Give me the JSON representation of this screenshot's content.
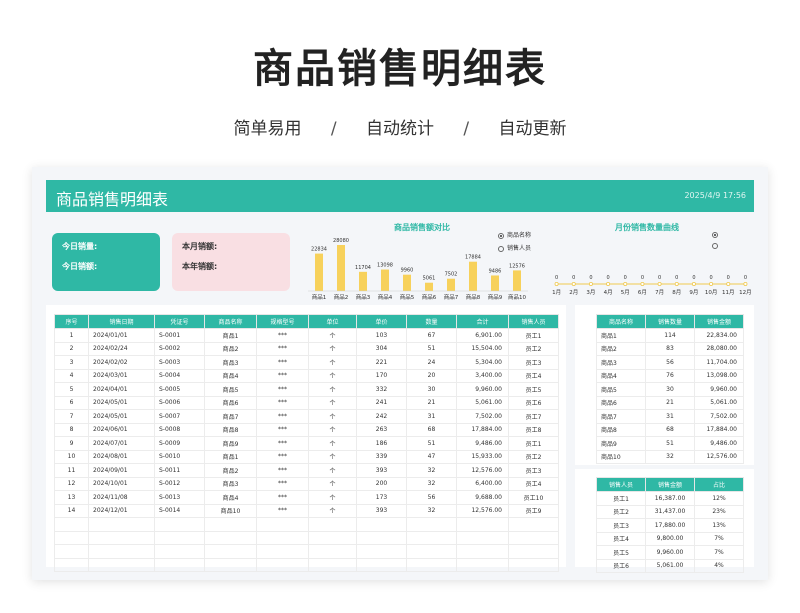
{
  "hero": {
    "title": "商品销售明细表",
    "tags": [
      "简单易用",
      "/",
      "自动统计",
      "/",
      "自动更新"
    ]
  },
  "sheet": {
    "title": "商品销售明细表",
    "date": "2025/4/9 17:56",
    "kpi": {
      "today_count": "今日销量:",
      "today_amount": "今日销额:",
      "month_amount": "本月销额:",
      "year_amount": "本年销额:"
    }
  },
  "colors": {
    "accent": "#2fb8a5",
    "bar": "#f7d15b",
    "pink": "#f9dfe3"
  },
  "chart_data": [
    {
      "type": "bar",
      "title": "商品销售额对比",
      "categories": [
        "商品1",
        "商品2",
        "商品3",
        "商品4",
        "商品5",
        "商品6",
        "商品7",
        "商品8",
        "商品9",
        "商品10"
      ],
      "values": [
        22834,
        28080,
        11704,
        13098,
        9960,
        5061,
        7502,
        17884,
        9486,
        12576
      ],
      "legend": [
        "商品名称",
        "销售人员"
      ],
      "legend_placement": "top-right",
      "grid": false
    },
    {
      "type": "line",
      "title": "月份销售数量曲线",
      "categories": [
        "1月",
        "2月",
        "3月",
        "4月",
        "5月",
        "6月",
        "7月",
        "8月",
        "9月",
        "10月",
        "11月",
        "12月"
      ],
      "values": [
        0,
        0,
        0,
        0,
        0,
        0,
        0,
        0,
        0,
        0,
        0,
        0
      ],
      "legend_placement": "top-right",
      "grid": false
    }
  ],
  "main_table": {
    "headers": [
      "序号",
      "销售日期",
      "凭证号",
      "商品名称",
      "规格型号",
      "单位",
      "单价",
      "数量",
      "合计",
      "销售人员"
    ],
    "rows": [
      [
        "1",
        "2024/01/01",
        "S-0001",
        "商品1",
        "***",
        "个",
        "103",
        "67",
        "6,901.00",
        "员工1"
      ],
      [
        "2",
        "2024/02/24",
        "S-0002",
        "商品2",
        "***",
        "个",
        "304",
        "51",
        "15,504.00",
        "员工2"
      ],
      [
        "3",
        "2024/02/02",
        "S-0003",
        "商品3",
        "***",
        "个",
        "221",
        "24",
        "5,304.00",
        "员工3"
      ],
      [
        "4",
        "2024/03/01",
        "S-0004",
        "商品4",
        "***",
        "个",
        "170",
        "20",
        "3,400.00",
        "员工4"
      ],
      [
        "5",
        "2024/04/01",
        "S-0005",
        "商品5",
        "***",
        "个",
        "332",
        "30",
        "9,960.00",
        "员工5"
      ],
      [
        "6",
        "2024/05/01",
        "S-0006",
        "商品6",
        "***",
        "个",
        "241",
        "21",
        "5,061.00",
        "员工6"
      ],
      [
        "7",
        "2024/05/01",
        "S-0007",
        "商品7",
        "***",
        "个",
        "242",
        "31",
        "7,502.00",
        "员工7"
      ],
      [
        "8",
        "2024/06/01",
        "S-0008",
        "商品8",
        "***",
        "个",
        "263",
        "68",
        "17,884.00",
        "员工8"
      ],
      [
        "9",
        "2024/07/01",
        "S-0009",
        "商品9",
        "***",
        "个",
        "186",
        "51",
        "9,486.00",
        "员工1"
      ],
      [
        "10",
        "2024/08/01",
        "S-0010",
        "商品1",
        "***",
        "个",
        "339",
        "47",
        "15,933.00",
        "员工2"
      ],
      [
        "11",
        "2024/09/01",
        "S-0011",
        "商品2",
        "***",
        "个",
        "393",
        "32",
        "12,576.00",
        "员工3"
      ],
      [
        "12",
        "2024/10/01",
        "S-0012",
        "商品3",
        "***",
        "个",
        "200",
        "32",
        "6,400.00",
        "员工4"
      ],
      [
        "13",
        "2024/11/08",
        "S-0013",
        "商品4",
        "***",
        "个",
        "173",
        "56",
        "9,688.00",
        "员工10"
      ],
      [
        "14",
        "2024/12/01",
        "S-0014",
        "商品10",
        "***",
        "个",
        "393",
        "32",
        "12,576.00",
        "员工9"
      ],
      [
        "",
        "",
        "",
        "",
        "",
        "",
        "",
        "",
        "",
        ""
      ],
      [
        "",
        "",
        "",
        "",
        "",
        "",
        "",
        "",
        "",
        ""
      ],
      [
        "",
        "",
        "",
        "",
        "",
        "",
        "",
        "",
        "",
        ""
      ],
      [
        "",
        "",
        "",
        "",
        "",
        "",
        "",
        "",
        "",
        ""
      ]
    ]
  },
  "product_table": {
    "headers": [
      "商品名称",
      "销售数量",
      "销售金额"
    ],
    "rows": [
      [
        "商品1",
        "114",
        "22,834.00"
      ],
      [
        "商品2",
        "83",
        "28,080.00"
      ],
      [
        "商品3",
        "56",
        "11,704.00"
      ],
      [
        "商品4",
        "76",
        "13,098.00"
      ],
      [
        "商品5",
        "30",
        "9,960.00"
      ],
      [
        "商品6",
        "21",
        "5,061.00"
      ],
      [
        "商品7",
        "31",
        "7,502.00"
      ],
      [
        "商品8",
        "68",
        "17,884.00"
      ],
      [
        "商品9",
        "51",
        "9,486.00"
      ],
      [
        "商品10",
        "32",
        "12,576.00"
      ]
    ]
  },
  "staff_table": {
    "headers": [
      "销售人员",
      "销售金额",
      "占比"
    ],
    "rows": [
      [
        "员工1",
        "16,387.00",
        "12%"
      ],
      [
        "员工2",
        "31,437.00",
        "23%"
      ],
      [
        "员工3",
        "17,880.00",
        "13%"
      ],
      [
        "员工4",
        "9,800.00",
        "7%"
      ],
      [
        "员工5",
        "9,960.00",
        "7%"
      ],
      [
        "员工6",
        "5,061.00",
        "4%"
      ]
    ]
  }
}
